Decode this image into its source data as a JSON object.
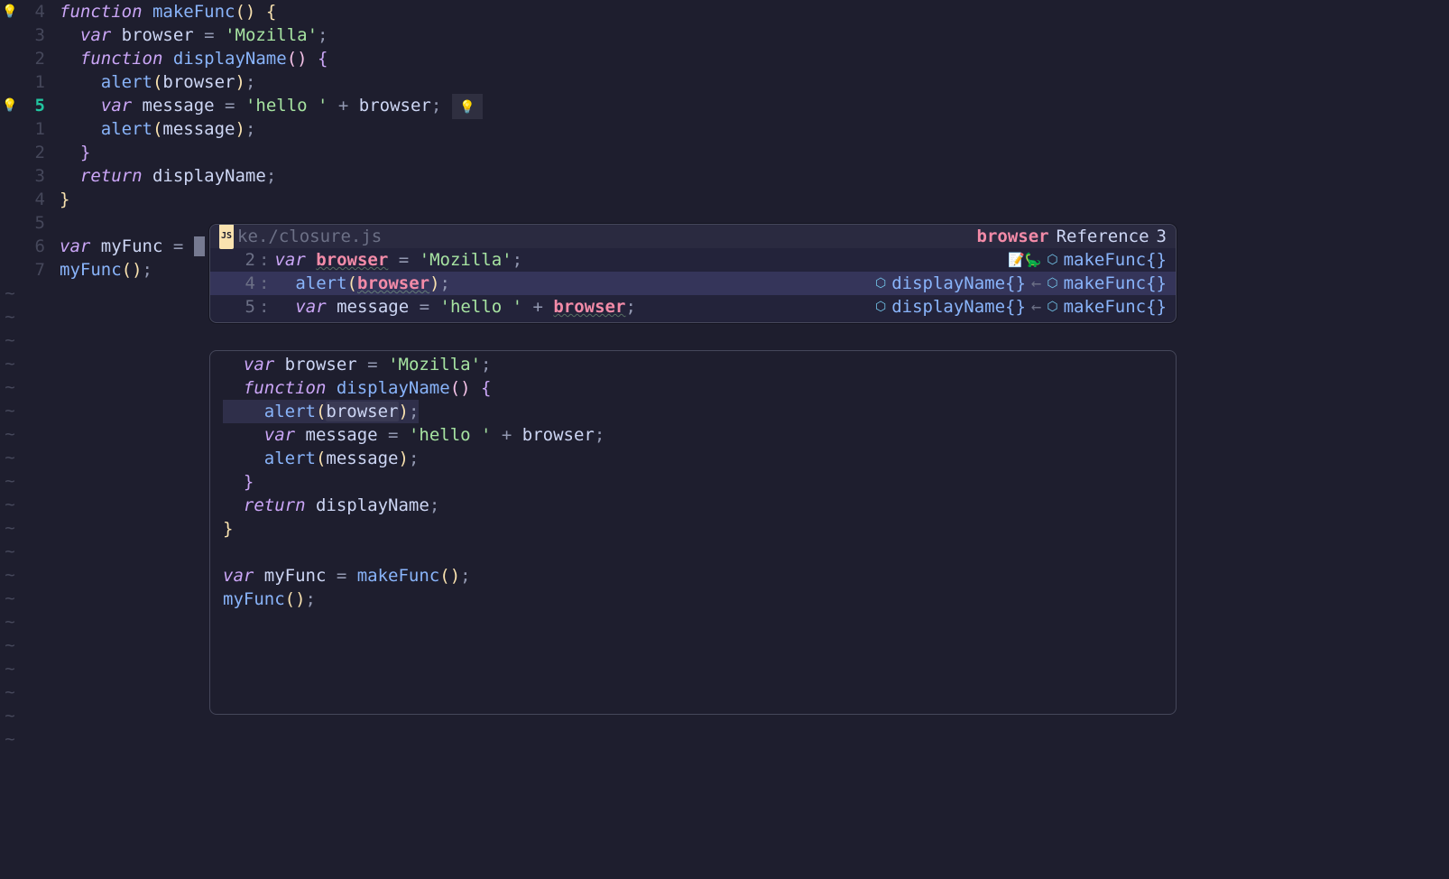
{
  "editor": {
    "gutter": [
      "4",
      "3",
      "2",
      "1",
      "5",
      "1",
      "2",
      "3",
      "4",
      "5",
      "6",
      "7"
    ],
    "gutter_current_index": 4,
    "sign_bulbs": [
      0,
      4
    ],
    "lines": [
      {
        "tokens": [
          [
            "kw",
            "function "
          ],
          [
            "fnname",
            "makeFunc"
          ],
          [
            "paren-yellow",
            "()"
          ],
          [
            "punc",
            " "
          ],
          [
            "curly-y",
            "{"
          ]
        ]
      },
      {
        "tokens": [
          [
            "punc",
            "  "
          ],
          [
            "kw",
            "var "
          ],
          [
            "var",
            "browser "
          ],
          [
            "punc",
            "= "
          ],
          [
            "str",
            "'Mozilla'"
          ],
          [
            "punc",
            ";"
          ]
        ]
      },
      {
        "tokens": [
          [
            "punc",
            "  "
          ],
          [
            "kw",
            "function "
          ],
          [
            "fnname",
            "displayName"
          ],
          [
            "paren-pink",
            "()"
          ],
          [
            "punc",
            " "
          ],
          [
            "curly-p",
            "{"
          ]
        ]
      },
      {
        "tokens": [
          [
            "punc",
            "    "
          ],
          [
            "call",
            "alert"
          ],
          [
            "paren-yellow",
            "("
          ],
          [
            "var",
            "browser"
          ],
          [
            "paren-yellow",
            ")"
          ],
          [
            "punc",
            ";"
          ]
        ]
      },
      {
        "tokens": [
          [
            "punc",
            "    "
          ],
          [
            "kw",
            "var "
          ],
          [
            "var",
            "message "
          ],
          [
            "punc",
            "= "
          ],
          [
            "str",
            "'hello '"
          ],
          [
            "punc",
            " + "
          ],
          [
            "var",
            "browser"
          ],
          [
            "punc",
            ";"
          ]
        ],
        "bulb": true
      },
      {
        "tokens": [
          [
            "punc",
            "    "
          ],
          [
            "call",
            "alert"
          ],
          [
            "paren-yellow",
            "("
          ],
          [
            "var",
            "message"
          ],
          [
            "paren-yellow",
            ")"
          ],
          [
            "punc",
            ";"
          ]
        ]
      },
      {
        "tokens": [
          [
            "punc",
            "  "
          ],
          [
            "curly-p",
            "}"
          ]
        ]
      },
      {
        "tokens": [
          [
            "punc",
            "  "
          ],
          [
            "kw",
            "return "
          ],
          [
            "var",
            "displayName"
          ],
          [
            "punc",
            ";"
          ]
        ]
      },
      {
        "tokens": [
          [
            "curly-y",
            "}"
          ]
        ]
      },
      {
        "tokens": [
          [
            "punc",
            ""
          ]
        ]
      },
      {
        "tokens": [
          [
            "kw",
            "var "
          ],
          [
            "var",
            "myFunc "
          ],
          [
            "punc",
            "= "
          ]
        ],
        "cursor_after": true
      },
      {
        "tokens": [
          [
            "call",
            "myFunc"
          ],
          [
            "paren-yellow",
            "()"
          ],
          [
            "punc",
            ";"
          ]
        ]
      }
    ],
    "tilde_rows": 20
  },
  "popup": {
    "filepath": "./closure.js",
    "filepath_prefix": "ke",
    "ref_word": "browser",
    "ref_label": "Reference",
    "ref_count": "3",
    "header_scope": "makeFunc{}",
    "header_emoji": "📝🦕",
    "rows": [
      {
        "ln": "2",
        "pre": "var ",
        "hl": "browser",
        "post": " = 'Mozilla';",
        "scope_left": "",
        "scope_right": "",
        "sel": false
      },
      {
        "ln": "4",
        "pre": "  alert(",
        "hl": "browser",
        "post": ");",
        "scope_left": "displayName{}",
        "scope_right": "makeFunc{}",
        "sel": true
      },
      {
        "ln": "5",
        "pre": "  var message = 'hello ' + ",
        "hl": "browser",
        "post": ";",
        "scope_left": "displayName{}",
        "scope_right": "makeFunc{}",
        "sel": false
      }
    ]
  },
  "preview": {
    "lines": [
      {
        "indent": "  ",
        "tokens": [
          [
            "kw",
            "var "
          ],
          [
            "var",
            "browser "
          ],
          [
            "punc",
            "= "
          ],
          [
            "str",
            "'Mozilla'"
          ],
          [
            "punc",
            ";"
          ]
        ]
      },
      {
        "indent": "  ",
        "tokens": [
          [
            "kw",
            "function "
          ],
          [
            "fnname",
            "displayName"
          ],
          [
            "paren-pink",
            "()"
          ],
          [
            "punc",
            " "
          ],
          [
            "curly-p",
            "{"
          ]
        ]
      },
      {
        "indent": "    ",
        "tokens": [
          [
            "call",
            "alert"
          ],
          [
            "paren-yellow",
            "("
          ],
          [
            "var hl-word",
            "browser"
          ],
          [
            "paren-yellow",
            ")"
          ],
          [
            "punc",
            ";"
          ]
        ],
        "hl": true
      },
      {
        "indent": "    ",
        "tokens": [
          [
            "kw",
            "var "
          ],
          [
            "var",
            "message "
          ],
          [
            "punc",
            "= "
          ],
          [
            "str",
            "'hello '"
          ],
          [
            "punc",
            " + "
          ],
          [
            "var",
            "browser"
          ],
          [
            "punc",
            ";"
          ]
        ]
      },
      {
        "indent": "    ",
        "tokens": [
          [
            "call",
            "alert"
          ],
          [
            "paren-yellow",
            "("
          ],
          [
            "var",
            "message"
          ],
          [
            "paren-yellow",
            ")"
          ],
          [
            "punc",
            ";"
          ]
        ]
      },
      {
        "indent": "  ",
        "tokens": [
          [
            "curly-p",
            "}"
          ]
        ]
      },
      {
        "indent": "  ",
        "tokens": [
          [
            "kw",
            "return "
          ],
          [
            "var",
            "displayName"
          ],
          [
            "punc",
            ";"
          ]
        ]
      },
      {
        "indent": "",
        "tokens": [
          [
            "curly-y",
            "}"
          ]
        ]
      },
      {
        "indent": "",
        "tokens": [
          [
            "punc",
            ""
          ]
        ]
      },
      {
        "indent": "",
        "tokens": [
          [
            "kw",
            "var "
          ],
          [
            "var",
            "myFunc "
          ],
          [
            "punc",
            "= "
          ],
          [
            "call",
            "makeFunc"
          ],
          [
            "paren-yellow",
            "()"
          ],
          [
            "punc",
            ";"
          ]
        ]
      },
      {
        "indent": "",
        "tokens": [
          [
            "call",
            "myFunc"
          ],
          [
            "paren-yellow",
            "()"
          ],
          [
            "punc",
            ";"
          ]
        ]
      }
    ]
  }
}
